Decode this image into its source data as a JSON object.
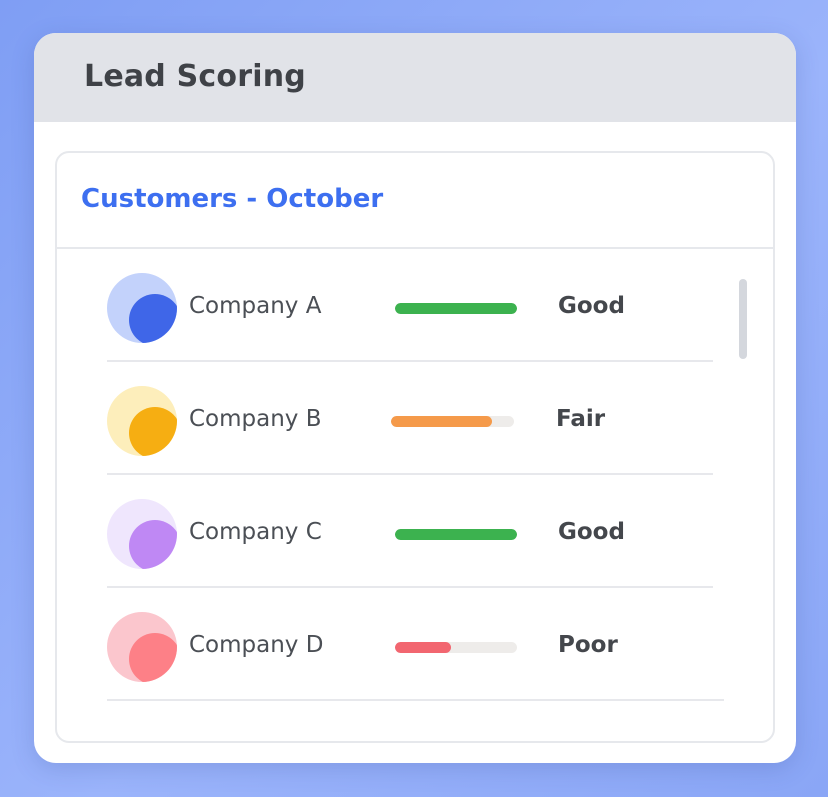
{
  "window": {
    "title": "Lead Scoring"
  },
  "card": {
    "title": "Customers - October"
  },
  "customers": [
    {
      "name": "Company A",
      "rating": "Good",
      "score_fraction": 1.0,
      "bar_color": "#3cb24f",
      "avatar_light": "#c3d2fb",
      "avatar_dark": "#3f66e8"
    },
    {
      "name": "Company B",
      "rating": "Fair",
      "score_fraction": 0.82,
      "bar_color": "#f59a4a",
      "avatar_light": "#fdeebb",
      "avatar_dark": "#f6ae12"
    },
    {
      "name": "Company C",
      "rating": "Good",
      "score_fraction": 1.0,
      "bar_color": "#3cb24f",
      "avatar_light": "#efe6fd",
      "avatar_dark": "#bf88f4"
    },
    {
      "name": "Company D",
      "rating": "Poor",
      "score_fraction": 0.46,
      "bar_color": "#f26670",
      "avatar_light": "#fbc6cd",
      "avatar_dark": "#fd8087"
    }
  ],
  "colors": {
    "accent": "#3d6ff0",
    "header_background": "#e1e3e8",
    "page_background": "#8aa6f6"
  }
}
